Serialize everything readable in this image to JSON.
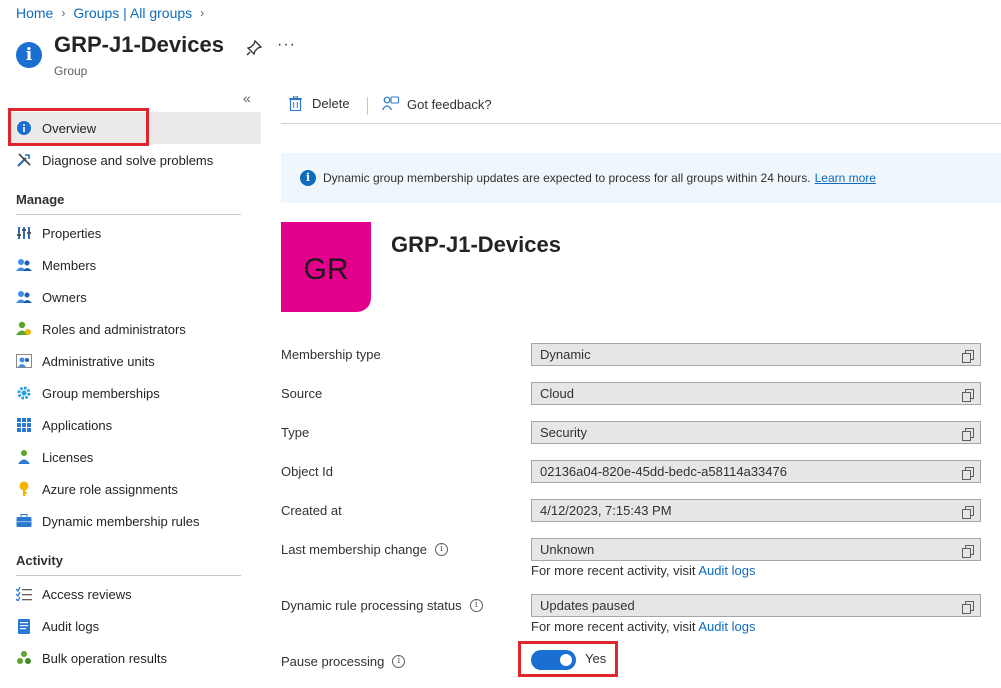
{
  "breadcrumb": {
    "home": "Home",
    "groups": "Groups | All groups"
  },
  "header": {
    "title": "GRP-J1-Devices",
    "subtitle": "Group",
    "more": "···"
  },
  "sidebar": {
    "collapse": "«",
    "top_items": [
      {
        "label": "Overview",
        "icon": "info-icon"
      },
      {
        "label": "Diagnose and solve problems",
        "icon": "wrench-icon"
      }
    ],
    "manage_title": "Manage",
    "manage_items": [
      {
        "label": "Properties",
        "icon": "properties-icon"
      },
      {
        "label": "Members",
        "icon": "members-icon"
      },
      {
        "label": "Owners",
        "icon": "owners-icon"
      },
      {
        "label": "Roles and administrators",
        "icon": "roles-icon"
      },
      {
        "label": "Administrative units",
        "icon": "admin-units-icon"
      },
      {
        "label": "Group memberships",
        "icon": "gear-icon"
      },
      {
        "label": "Applications",
        "icon": "apps-grid-icon"
      },
      {
        "label": "Licenses",
        "icon": "licenses-icon"
      },
      {
        "label": "Azure role assignments",
        "icon": "key-icon"
      },
      {
        "label": "Dynamic membership rules",
        "icon": "briefcase-icon"
      }
    ],
    "activity_title": "Activity",
    "activity_items": [
      {
        "label": "Access reviews",
        "icon": "checklist-icon"
      },
      {
        "label": "Audit logs",
        "icon": "audit-log-icon"
      },
      {
        "label": "Bulk operation results",
        "icon": "bulk-icon"
      }
    ]
  },
  "toolbar": {
    "delete": "Delete",
    "feedback": "Got feedback?"
  },
  "banner": {
    "text": "Dynamic group membership updates are expected to process for all groups within 24 hours.",
    "link": "Learn more"
  },
  "group": {
    "initials": "GR",
    "name": "GRP-J1-Devices"
  },
  "properties": [
    {
      "label": "Membership type",
      "value": "Dynamic"
    },
    {
      "label": "Source",
      "value": "Cloud"
    },
    {
      "label": "Type",
      "value": "Security"
    },
    {
      "label": "Object Id",
      "value": "02136a04-820e-45dd-bedc-a58114a33476"
    },
    {
      "label": "Created at",
      "value": "4/12/2023, 7:15:43 PM"
    },
    {
      "label": "Last membership change",
      "value": "Unknown"
    },
    {
      "label": "Dynamic rule processing status",
      "value": "Updates paused"
    }
  ],
  "notes": {
    "prefix": "For more recent activity, visit",
    "link": "Audit logs"
  },
  "pause": {
    "label": "Pause processing",
    "value": "Yes",
    "on": true
  },
  "colors": {
    "accent": "#0f6cbd",
    "tile": "#e3008c",
    "highlight": "#e0262d"
  }
}
